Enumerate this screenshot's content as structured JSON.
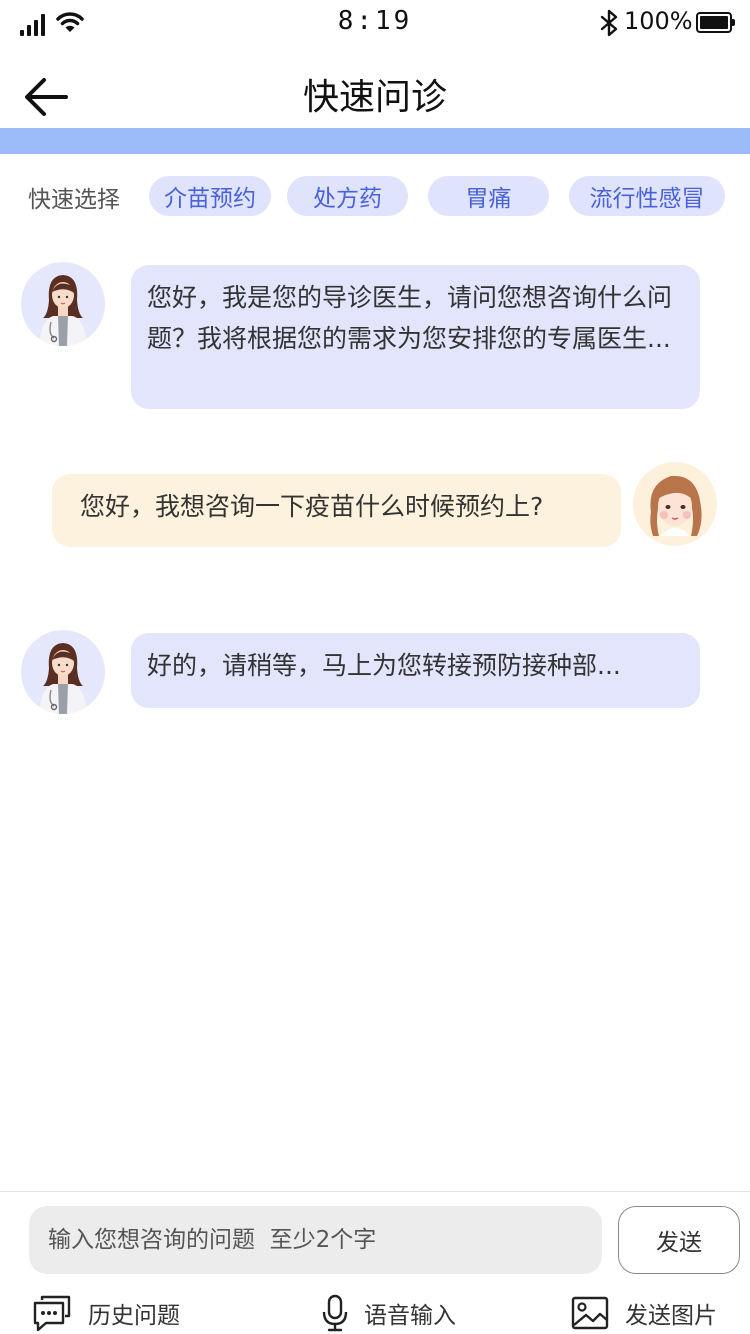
{
  "status_bar": {
    "time": "8:19",
    "battery_percent": "100%",
    "signal_icon": "signal-bars-icon",
    "wifi_icon": "wifi-icon",
    "bluetooth_icon": "bluetooth-icon",
    "battery_icon": "battery-icon"
  },
  "nav": {
    "title": "快速问诊",
    "back_icon": "arrow-left-icon"
  },
  "colors": {
    "band": "#9bbcf8",
    "chip_bg": "#dfe3fb",
    "chip_text": "#4a62d9",
    "bot_bubble": "#e2e5fc",
    "user_bubble": "#fdf2dd"
  },
  "quick_select": {
    "label": "快速选择",
    "chips": [
      "介苗预约",
      "处方药",
      "胃痛",
      "流行性感冒"
    ]
  },
  "messages": [
    {
      "sender": "doctor",
      "text": "您好，我是您的导诊医生，请问您想咨询什么问题？我将根据您的需求为您安排您的专属医生..."
    },
    {
      "sender": "user",
      "text": "您好，我想咨询一下疫苗什么时候预约上?"
    },
    {
      "sender": "doctor",
      "text": "好的，请稍等，马上为您转接预防接种部..."
    }
  ],
  "composer": {
    "placeholder": "输入您想咨询的问题  至少2个字",
    "send_label": "发送"
  },
  "toolbar": {
    "history_label": "历史问题",
    "history_icon": "chat-bubble-icon",
    "voice_label": "语音输入",
    "voice_icon": "microphone-icon",
    "image_label": "发送图片",
    "image_icon": "image-icon"
  }
}
